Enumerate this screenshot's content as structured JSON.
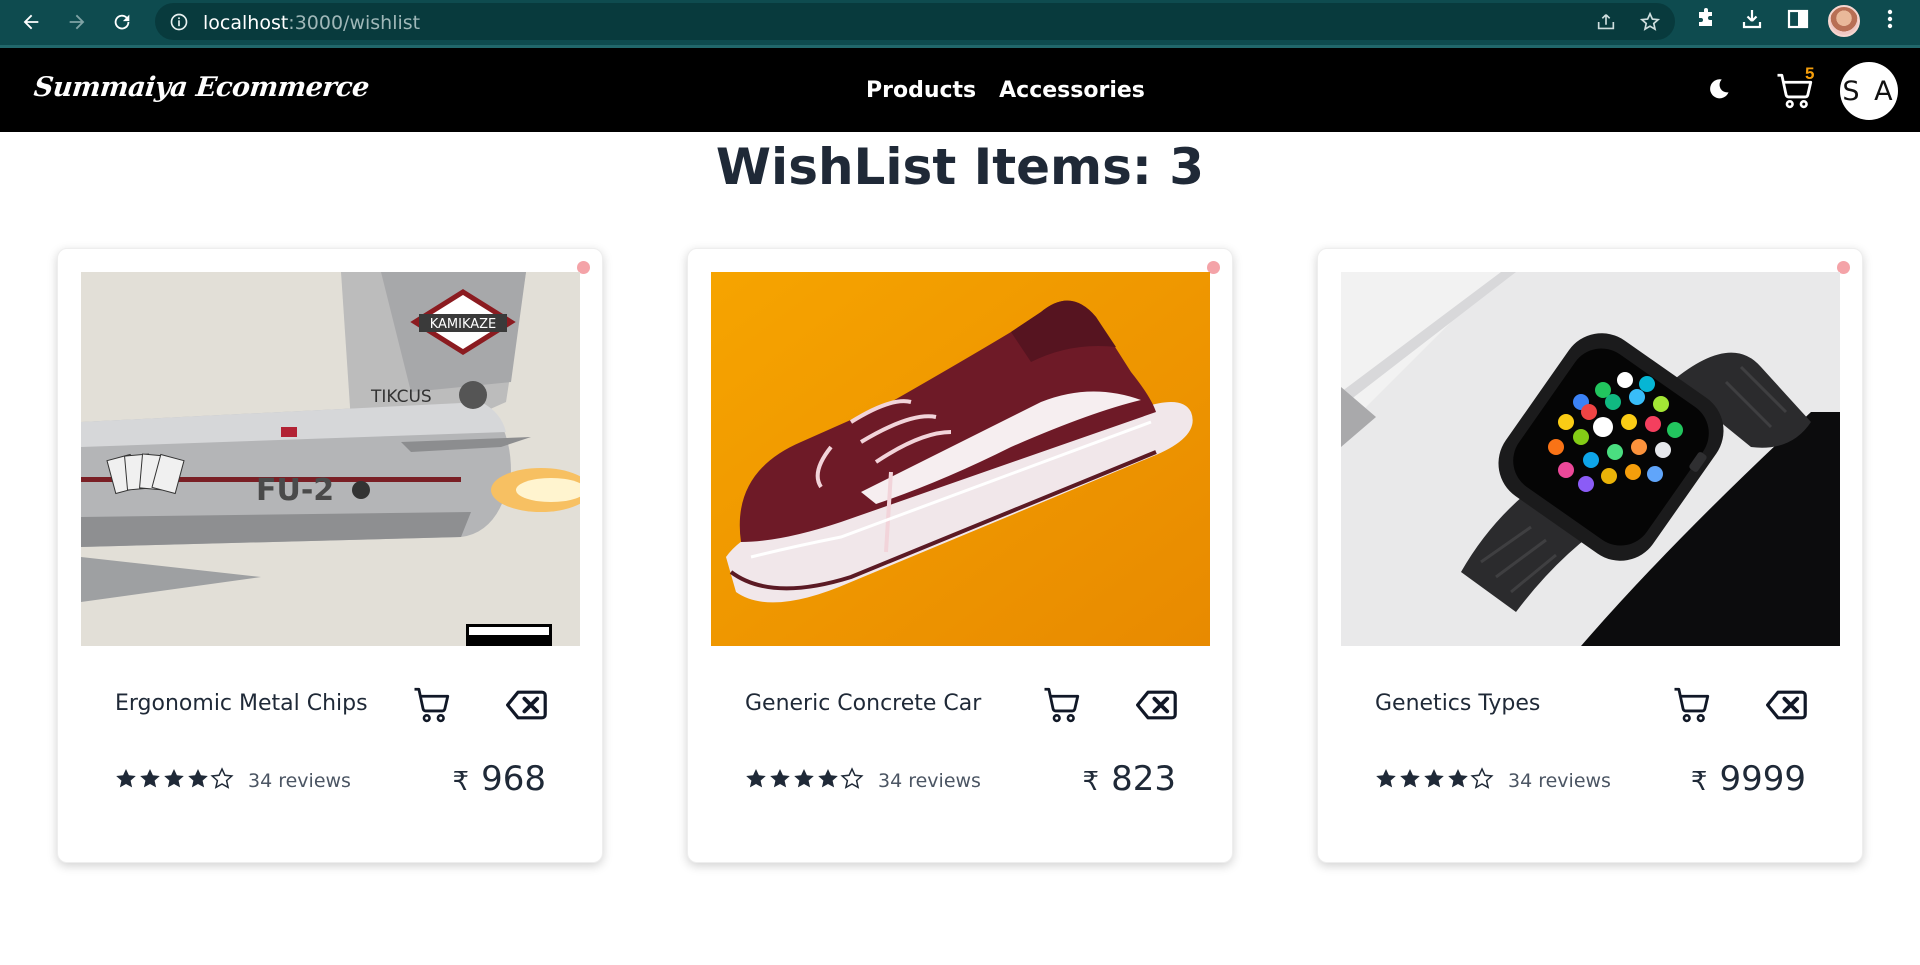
{
  "browser": {
    "url_host": "localhost",
    "url_path": ":3000/wishlist",
    "icons": [
      "back-arrow-icon",
      "forward-arrow-icon",
      "reload-icon",
      "info-icon",
      "share-icon",
      "star-icon",
      "extensions-icon",
      "download-icon",
      "side-panel-icon",
      "menu-icon"
    ]
  },
  "navbar": {
    "brand": "Summaiya Ecommerce",
    "links": [
      "Products",
      "Accessories"
    ],
    "cart_count": "5",
    "avatar_initials": "S A"
  },
  "page": {
    "title": "WishList Items: 3"
  },
  "products": [
    {
      "name": "Ergonomic Metal Chips",
      "reviews": "34 reviews",
      "currency": "₹",
      "price": "968",
      "rating": 4,
      "image": "jet-plane-album-art"
    },
    {
      "name": "Generic Concrete Car",
      "reviews": "34 reviews",
      "currency": "₹",
      "price": "823",
      "rating": 4,
      "image": "maroon-sneaker"
    },
    {
      "name": "Genetics Types",
      "reviews": "34 reviews",
      "currency": "₹",
      "price": "9999",
      "rating": 4,
      "image": "smart-watch"
    }
  ],
  "colors": {
    "browser_bar": "#0e4b4f",
    "navbar": "#000000",
    "cart_badge": "#f59e0b",
    "wishlist_dot": "#f4a3a8"
  }
}
